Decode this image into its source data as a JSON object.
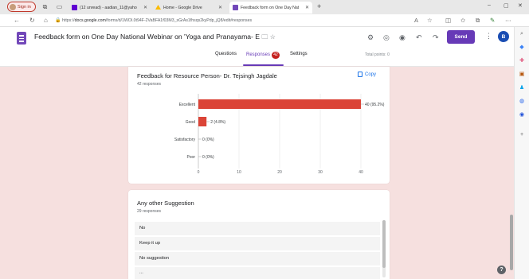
{
  "browser": {
    "signin_label": "Sign in",
    "tabs": [
      {
        "label": "(12 unread) - aadian_11@yaho",
        "color": "#6001d2",
        "active": false
      },
      {
        "label": "Home - Google Drive",
        "color": "#fbbc04",
        "active": false
      },
      {
        "label": "Feedback form on One Day Nat",
        "color": "#7248b9",
        "active": true
      }
    ],
    "url_prefix": "https://",
    "url_host": "docs.google.com",
    "url_path": "/forms/d/1WOI.0t94F-2VaBFA1f03M3_sGrAs1fhsqs2kyPdp_jQ8/edit#responses"
  },
  "form": {
    "title": "Feedback form on One Day National Webinar on 'Yoga and Pranayama- E",
    "send_label": "Send",
    "user_initial": "B",
    "tabs": {
      "questions": "Questions",
      "responses": "Responses",
      "responses_count": "42",
      "settings": "Settings"
    },
    "total_points": "Total points: 0"
  },
  "question1": {
    "title": "Feedback for Resource Person- Dr. Tejsingh Jagdale",
    "responses": "42 responses",
    "copy_label": "Copy"
  },
  "chart_data": {
    "type": "bar",
    "orientation": "horizontal",
    "categories": [
      "Excellent",
      "Good",
      "Satisfactory",
      "Poor"
    ],
    "values": [
      40,
      2,
      0,
      0
    ],
    "data_labels": [
      "40 (95.2%)",
      "2 (4.8%)",
      "0 (0%)",
      "0 (0%)"
    ],
    "xticks": [
      0,
      10,
      20,
      30,
      40
    ],
    "xlim": [
      0,
      40
    ],
    "bar_color": "#db4437",
    "grid": true
  },
  "question2": {
    "title": "Any other Suggestion",
    "responses": "29 responses",
    "answers": [
      "No",
      "Keep it up",
      "No suggestion",
      "..."
    ]
  },
  "colors": {
    "accent": "#673ab7",
    "content_bg": "#f6e0df"
  }
}
